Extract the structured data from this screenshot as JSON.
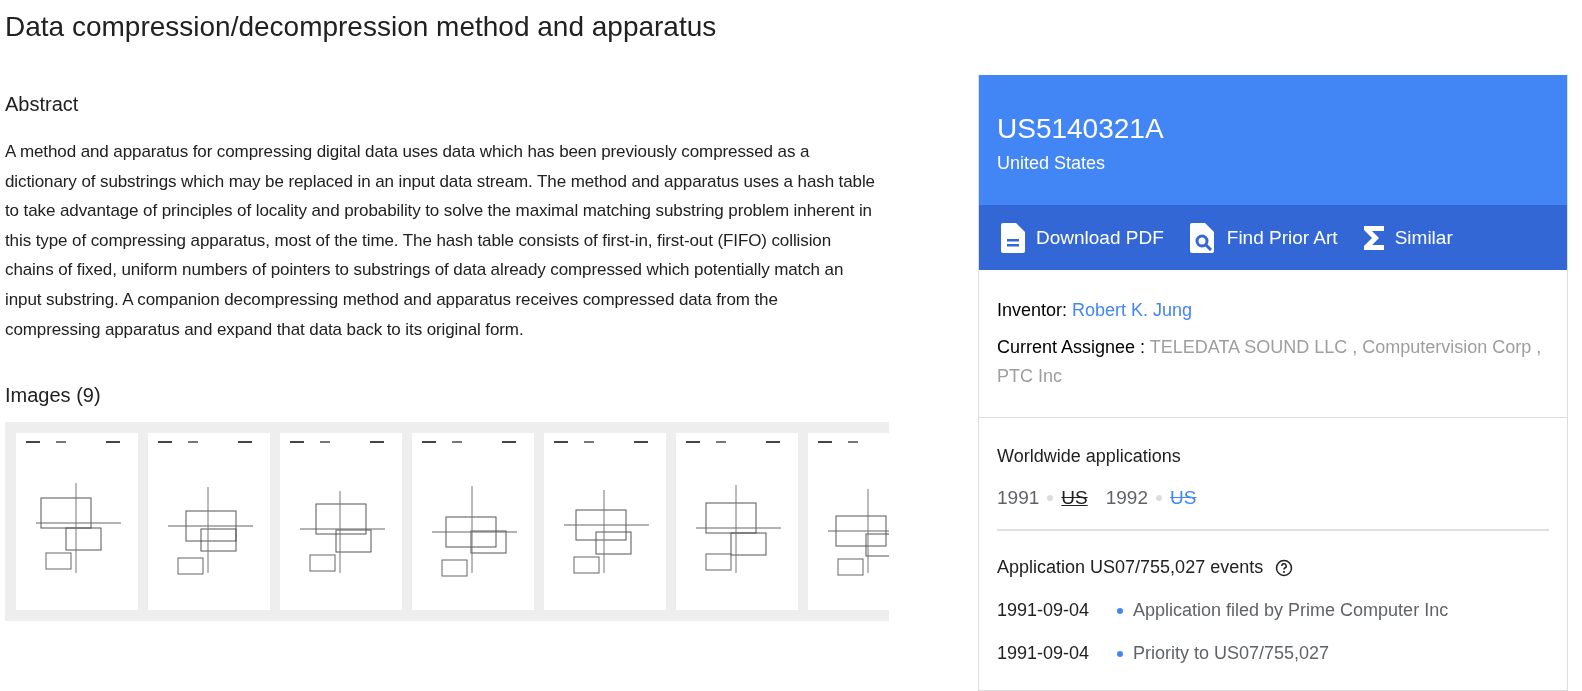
{
  "title": "Data compression/decompression method and apparatus",
  "abstract": {
    "heading": "Abstract",
    "text": "A method and apparatus for compressing digital data uses data which has been previously compressed as a dictionary of substrings which may be replaced in an input data stream. The method and apparatus uses a hash table to take advantage of principles of locality and probability to solve the maximal matching substring problem inherent in this type of compressing apparatus, most of the time. The hash table consists of first-in, first-out (FIFO) collision chains of fixed, uniform numbers of pointers to substrings of data already compressed which potentially match an input substring. A companion decompressing method and apparatus receives compressed data from the compressing apparatus and expand that data back to its original form."
  },
  "images": {
    "heading": "Images (9)"
  },
  "side": {
    "number": "US5140321A",
    "country": "United States",
    "actions": [
      {
        "kind": "pdf",
        "label": "Download PDF"
      },
      {
        "kind": "prior-art",
        "label": "Find Prior Art"
      },
      {
        "kind": "similar",
        "label": "Similar"
      }
    ],
    "inventor_label": "Inventor:",
    "inventor": "Robert K. Jung",
    "assignee_label": "Current Assignee :",
    "assignee": "TELEDATA SOUND LLC , Computervision Corp , PTC Inc",
    "worldwide": {
      "heading": "Worldwide applications",
      "items": [
        {
          "year": "1991",
          "country": "US",
          "current": true,
          "abandoned": true
        },
        {
          "year": "1992",
          "country": "US",
          "current": false,
          "abandoned": true
        }
      ]
    },
    "events": {
      "heading": "Application US07/755,027 events",
      "items": [
        {
          "date": "1991-09-04",
          "text": "Application filed by Prime Computer Inc"
        },
        {
          "date": "1991-09-04",
          "text": "Priority to US07/755,027"
        }
      ]
    }
  }
}
